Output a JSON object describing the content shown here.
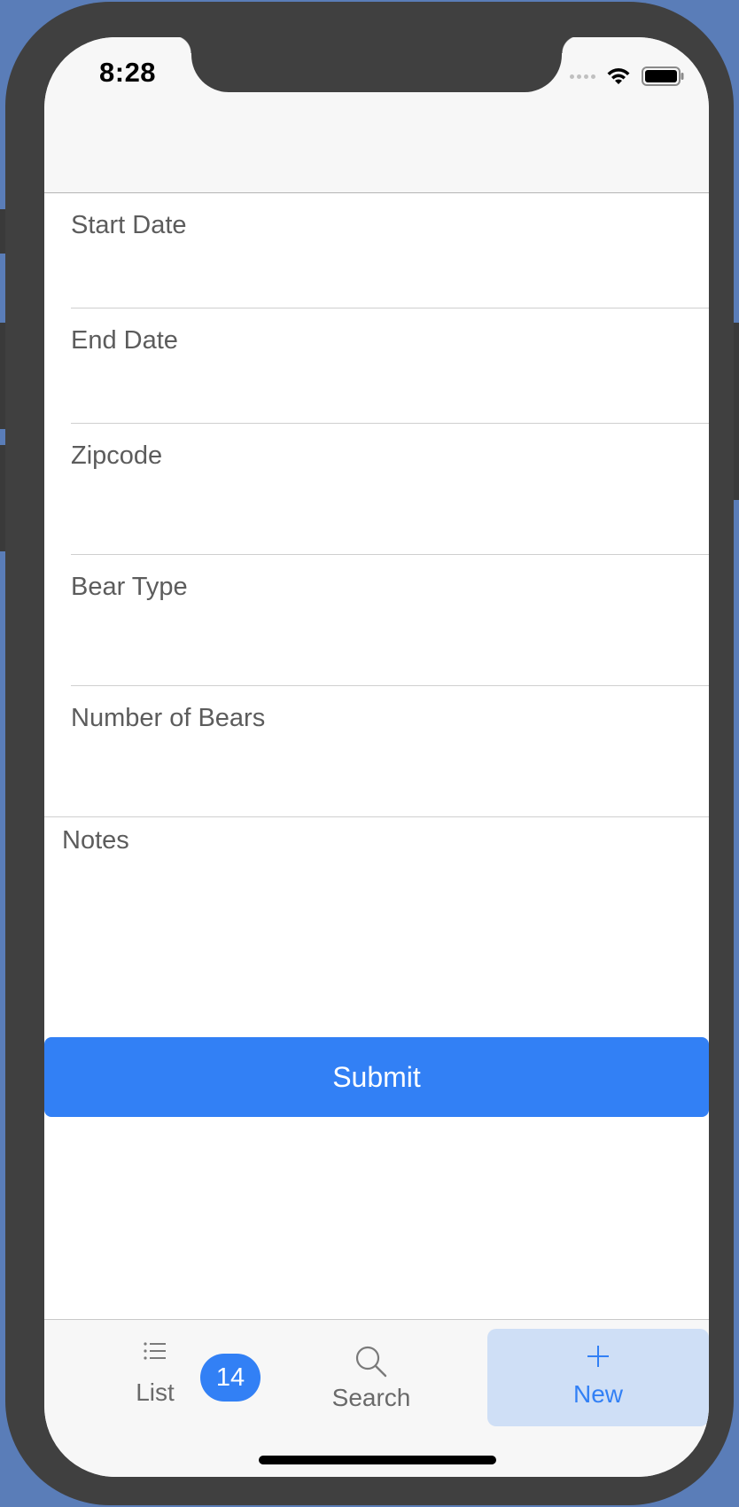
{
  "status_bar": {
    "time": "8:28"
  },
  "form": {
    "fields": [
      {
        "label": "Start Date"
      },
      {
        "label": "End Date"
      },
      {
        "label": "Zipcode"
      },
      {
        "label": "Bear Type"
      },
      {
        "label": "Number of Bears"
      }
    ],
    "notes_label": "Notes",
    "submit_label": "Submit"
  },
  "tab_bar": {
    "tabs": [
      {
        "label": "List",
        "icon": "list-icon",
        "badge": "14",
        "selected": false
      },
      {
        "label": "Search",
        "icon": "search-icon",
        "selected": false
      },
      {
        "label": "New",
        "icon": "plus-icon",
        "selected": true
      }
    ]
  },
  "colors": {
    "accent": "#3280f5",
    "selected_tab_bg": "#cfdff6",
    "label_text": "#5c5c5c",
    "background": "#5a7db8"
  }
}
